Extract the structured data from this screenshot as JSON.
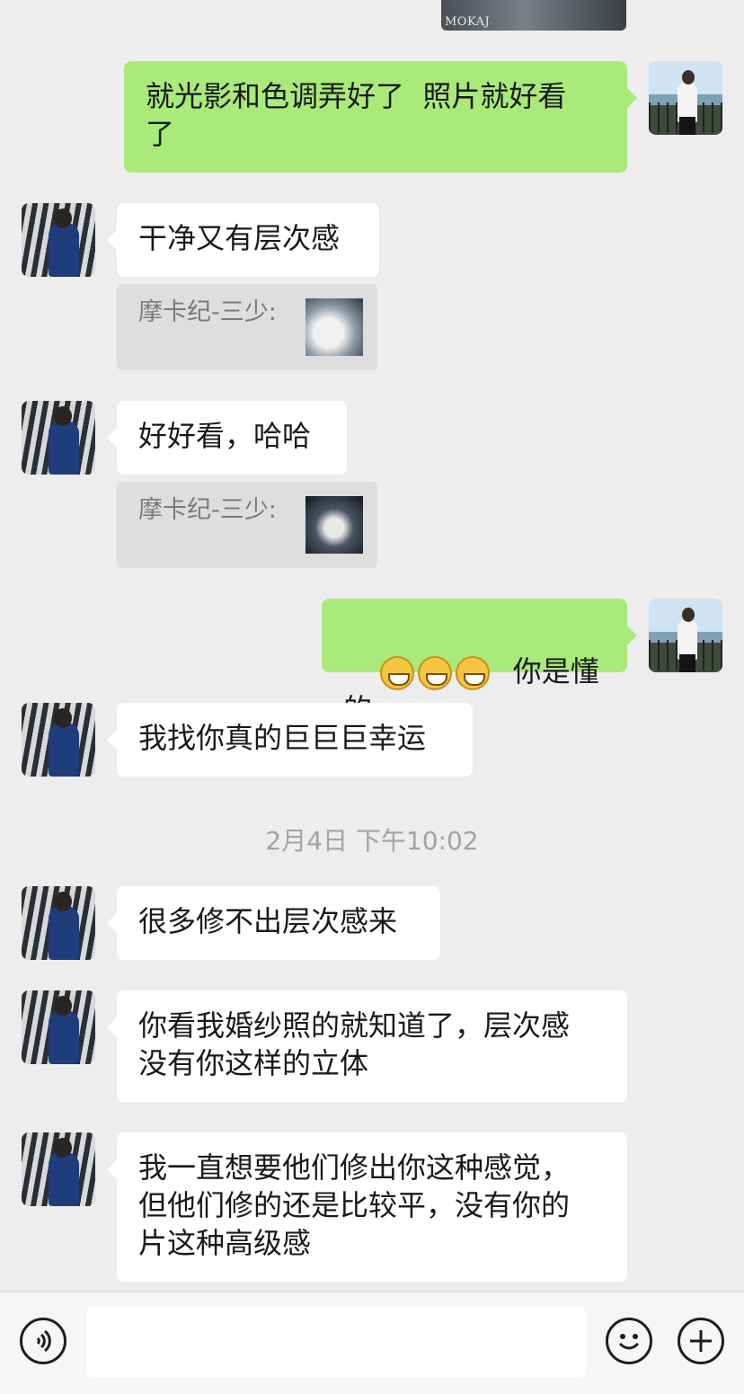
{
  "top_image": {
    "logo_text": "MOKAJ"
  },
  "messages": [
    {
      "side": "self",
      "text": "就光影和色调弄好了  照片就好看\n了"
    },
    {
      "side": "other",
      "text": "干净又有层次感"
    },
    {
      "side": "quote",
      "text": "摩卡纪-三少:"
    },
    {
      "side": "other",
      "text": "好好看，哈哈"
    },
    {
      "side": "quote",
      "text": "摩卡纪-三少:"
    },
    {
      "side": "self",
      "text": "你是懂的",
      "emoji_count": 3
    },
    {
      "side": "other",
      "text": "我找你真的巨巨巨幸运"
    },
    {
      "side": "other",
      "text": "很多修不出层次感来"
    },
    {
      "side": "other",
      "text": "你看我婚纱照的就知道了，层次感\n没有你这样的立体"
    },
    {
      "side": "other",
      "text": "我一直想要他们修出你这种感觉，\n但他们修的还是比较平，没有你的\n片这种高级感"
    }
  ],
  "timestamp": "2月4日 下午10:02",
  "input_bar": {
    "value": ""
  },
  "icons": {
    "voice": "voice-icon",
    "emoji": "emoji-icon",
    "plus": "plus-icon"
  }
}
